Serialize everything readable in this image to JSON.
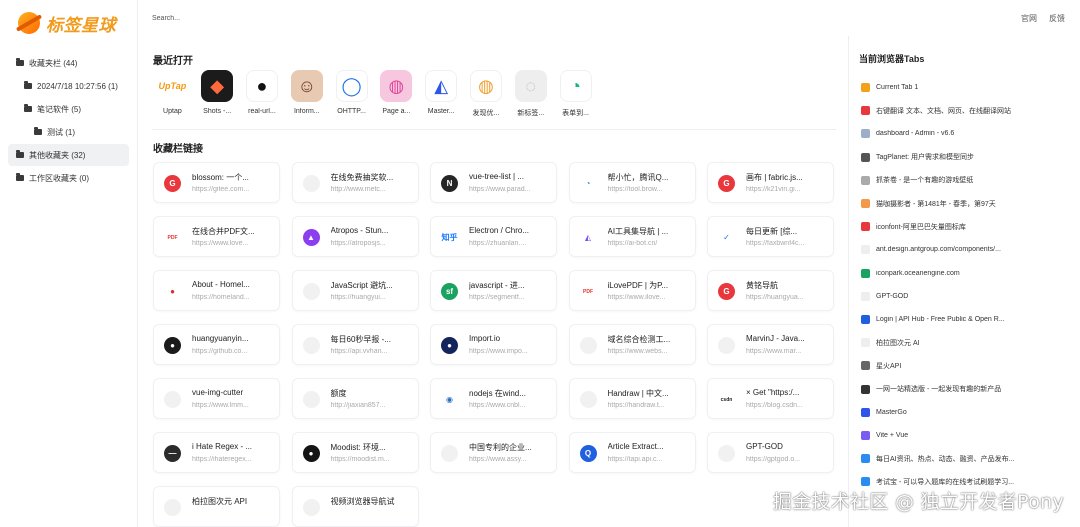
{
  "app": {
    "name": "标签星球"
  },
  "search": {
    "placeholder": "Search..."
  },
  "top_links": [
    "官网",
    "反馈"
  ],
  "sidebar": {
    "items": [
      {
        "label": "收藏夹栏 (44)",
        "level": 0,
        "active": false
      },
      {
        "label": "2024/7/18 10:27:56 (1)",
        "level": 1,
        "active": false
      },
      {
        "label": "笔记软件 (5)",
        "level": 1,
        "active": false
      },
      {
        "label": "测试 (1)",
        "level": 2,
        "active": false
      },
      {
        "label": "其他收藏夹 (32)",
        "level": 0,
        "active": true
      },
      {
        "label": "工作区收藏夹 (0)",
        "level": 0,
        "active": false
      }
    ]
  },
  "recent": {
    "title": "最近打开",
    "items": [
      {
        "label": "Uptap",
        "icon": "uptap-logo",
        "color": "#ffffff",
        "glyph": "UpTap",
        "fg": "#f59a12"
      },
      {
        "label": "Shots -...",
        "icon": "shots-logo",
        "color": "#1b1b1b",
        "glyph": "◆",
        "fg": "#ff6a3c"
      },
      {
        "label": "real-url...",
        "icon": "github-logo",
        "color": "#ffffff",
        "glyph": "●",
        "fg": "#111111"
      },
      {
        "label": "Inform...",
        "icon": "avatar-photo",
        "color": "#e8c9b2",
        "glyph": "☺",
        "fg": "#6b3d2a"
      },
      {
        "label": "OHTTP...",
        "icon": "ring-logo",
        "color": "#ffffff",
        "glyph": "◯",
        "fg": "#1e6fe8"
      },
      {
        "label": "Page a...",
        "icon": "dribbble-logo",
        "color": "#f6c7de",
        "glyph": "◍",
        "fg": "#e0489a"
      },
      {
        "label": "Master...",
        "icon": "mastergo-logo",
        "color": "#ffffff",
        "glyph": "◭",
        "fg": "#2e55e8"
      },
      {
        "label": "发现优...",
        "icon": "ball-logo",
        "color": "#ffffff",
        "glyph": "◍",
        "fg": "#f0a030"
      },
      {
        "label": "新标签...",
        "icon": "blank-tab-icon",
        "color": "#eeeeee",
        "glyph": "◌",
        "fg": "#bbbbbb"
      },
      {
        "label": "表单到...",
        "icon": "form-logo",
        "color": "#ffffff",
        "glyph": "◔",
        "fg": "#14b87a"
      }
    ]
  },
  "bookmarks": {
    "title": "收藏栏链接",
    "items": [
      {
        "title": "blossom: 一个...",
        "url": "https://gitee.com...",
        "icon": "gitee-icon",
        "color": "#e8383d",
        "glyph": "G"
      },
      {
        "title": "在线免费抽奖软...",
        "url": "http://www.metc...",
        "icon": "blank-icon",
        "color": "#f1f1f1",
        "glyph": ""
      },
      {
        "title": "vue-tree-list | ...",
        "url": "https://www.parad...",
        "icon": "nuxt-icon",
        "color": "#262626",
        "glyph": "N"
      },
      {
        "title": "帮小忙，腾讯Q...",
        "url": "https://tool.brow...",
        "icon": "tencent-icon",
        "color": "#ffffff",
        "glyph": "◔",
        "fg": "#2a8cf0"
      },
      {
        "title": "画布 | fabric.js...",
        "url": "https://k21vin.gi...",
        "icon": "gitee-icon",
        "color": "#e8383d",
        "glyph": "G"
      },
      {
        "title": "在线合并PDF文...",
        "url": "https://www.love...",
        "icon": "ilovepdf-icon",
        "color": "#ffffff",
        "glyph": "PDF",
        "fg": "#e5322d"
      },
      {
        "title": "Atropos - Stun...",
        "url": "https://atroposjs...",
        "icon": "atropos-icon",
        "color": "#8b3ef0",
        "glyph": "▲"
      },
      {
        "title": "Electron / Chro...",
        "url": "https://zhuanlan....",
        "icon": "zhihu-icon",
        "color": "#ffffff",
        "glyph": "知乎",
        "fg": "#1677ff"
      },
      {
        "title": "AI工具集导航 | ...",
        "url": "https://ai-bot.cn/",
        "icon": "aibot-icon",
        "color": "#ffffff",
        "glyph": "◭",
        "fg": "#7b4cf0"
      },
      {
        "title": "每日更新 [综...",
        "url": "https://faxbwnf4c...",
        "icon": "swoosh-icon",
        "color": "#ffffff",
        "glyph": "✓",
        "fg": "#1f6ed4"
      },
      {
        "title": "About - Homel...",
        "url": "https://homeland...",
        "icon": "homeland-icon",
        "color": "#ffffff",
        "glyph": "●",
        "fg": "#d22f2f"
      },
      {
        "title": "JavaScript 避坑...",
        "url": "https://huangyui...",
        "icon": "blank-icon",
        "color": "#f1f1f1",
        "glyph": ""
      },
      {
        "title": "javascript - 进...",
        "url": "https://segmentf...",
        "icon": "segmentfault-icon",
        "color": "#1aa260",
        "glyph": "sf"
      },
      {
        "title": "iLovePDF | 为P...",
        "url": "https://www.ilove...",
        "icon": "ilovepdf-icon",
        "color": "#ffffff",
        "glyph": "PDF",
        "fg": "#e5322d"
      },
      {
        "title": "黄铭导航",
        "url": "https://huangyua...",
        "icon": "gitee-icon",
        "color": "#e8383d",
        "glyph": "G"
      },
      {
        "title": "huangyuanyin...",
        "url": "https://github.co...",
        "icon": "github-icon",
        "color": "#1b1b1b",
        "glyph": "●"
      },
      {
        "title": "每日60秒早报 -...",
        "url": "https://api.vvhan...",
        "icon": "blank-icon",
        "color": "#f1f1f1",
        "glyph": ""
      },
      {
        "title": "Import.io",
        "url": "https://www.impo...",
        "icon": "importio-icon",
        "color": "#14245c",
        "glyph": "●"
      },
      {
        "title": "域名综合检测工...",
        "url": "https://www.webs...",
        "icon": "blank-icon",
        "color": "#f1f1f1",
        "glyph": ""
      },
      {
        "title": "MarvinJ - Java...",
        "url": "https://www.mar...",
        "icon": "blank-icon",
        "color": "#f1f1f1",
        "glyph": ""
      },
      {
        "title": "vue-img-cutter",
        "url": "https://www.lmm...",
        "icon": "blank-icon",
        "color": "#f1f1f1",
        "glyph": ""
      },
      {
        "title": "额度",
        "url": "http://jiaxian857...",
        "icon": "blank-icon",
        "color": "#f1f1f1",
        "glyph": ""
      },
      {
        "title": "nodejs 在wind...",
        "url": "https://www.cnbl...",
        "icon": "cnblogs-icon",
        "color": "#ffffff",
        "glyph": "◉",
        "fg": "#2a6fbf"
      },
      {
        "title": "Handraw | 中文...",
        "url": "https://handraw.t...",
        "icon": "blank-icon",
        "color": "#f1f1f1",
        "glyph": ""
      },
      {
        "title": "× Get \"https:/...",
        "url": "https://blog.csdn...",
        "icon": "csdn-icon",
        "color": "#ffffff",
        "glyph": "csdn",
        "fg": "#222222"
      },
      {
        "title": "i Hate Regex - ...",
        "url": "https://ihateregex...",
        "icon": "ihateregex-icon",
        "color": "#2b2b2b",
        "glyph": "—"
      },
      {
        "title": "Moodist: 环境...",
        "url": "https://moodist.m...",
        "icon": "moodist-icon",
        "color": "#141414",
        "glyph": "●"
      },
      {
        "title": "中国专利的企业...",
        "url": "https://www.assy...",
        "icon": "blank-icon",
        "color": "#f1f1f1",
        "glyph": ""
      },
      {
        "title": "Article Extract...",
        "url": "https://tapi.api.c...",
        "icon": "q-icon",
        "color": "#1f5fe0",
        "glyph": "Q"
      },
      {
        "title": "GPT-GOD",
        "url": "https://gptgod.o...",
        "icon": "blank-icon",
        "color": "#f1f1f1",
        "glyph": ""
      },
      {
        "title": "柏拉图次元 API",
        "url": "",
        "icon": "blank-icon",
        "color": "#f1f1f1",
        "glyph": ""
      },
      {
        "title": "视频浏览器导航试",
        "url": "",
        "icon": "blank-icon",
        "color": "#f1f1f1",
        "glyph": ""
      }
    ]
  },
  "browser_tabs": {
    "title": "当前浏览器Tabs",
    "items": [
      {
        "label": "Current Tab 1",
        "icon": "planet-icon",
        "color": "#f2a21a"
      },
      {
        "label": "右键翻译 文本、文档、网页、在线翻译网站",
        "icon": "translate-icon",
        "color": "#e8383d"
      },
      {
        "label": "dashboard - Admin - v6.6",
        "icon": "dashboard-icon",
        "color": "#9bb0c8"
      },
      {
        "label": "TagPlanet: 用户需求和模型同步",
        "icon": "github-icon",
        "color": "#555555"
      },
      {
        "label": "抓茶卷 - 是一个有趣的游戏壁纸",
        "icon": "leaf-icon",
        "color": "#aaaaaa"
      },
      {
        "label": "猫咖摄影者 - 第1481年 - 春季，第97天",
        "icon": "cat-icon",
        "color": "#f29a4a"
      },
      {
        "label": "iconfont-阿里巴巴矢量图标库",
        "icon": "iconfont-icon",
        "color": "#e8383d"
      },
      {
        "label": "ant.design.antgroup.com/components/...",
        "icon": "blank-icon",
        "color": "#eeeeee"
      },
      {
        "label": "iconpark.oceanengine.com",
        "icon": "iconpark-icon",
        "color": "#1aa260"
      },
      {
        "label": "GPT-GOD",
        "icon": "blank-icon",
        "color": "#eeeeee"
      },
      {
        "label": "Login | API Hub - Free Public & Open R...",
        "icon": "q-icon",
        "color": "#1f5fe0"
      },
      {
        "label": "柏拉图次元 AI",
        "icon": "blank-icon",
        "color": "#eeeeee"
      },
      {
        "label": "星火API",
        "icon": "spark-icon",
        "color": "#666666"
      },
      {
        "label": "一网一站精选版 - 一起发现有趣的新产品",
        "icon": "m-icon",
        "color": "#333333"
      },
      {
        "label": "MasterGo",
        "icon": "mastergo-icon",
        "color": "#2e55e8"
      },
      {
        "label": "Vite + Vue",
        "icon": "vite-icon",
        "color": "#7a5cf0"
      },
      {
        "label": "每日AI资讯、热点、动态、融资、产品发布...",
        "icon": "ai-news-icon",
        "color": "#2a8cf0"
      },
      {
        "label": "考试宝 - 可以导入题库的在线考试刷题学习...",
        "icon": "exam-icon",
        "color": "#2a8cf0"
      }
    ]
  },
  "watermark": "掘金技术社区 @ 独立开发者Pony"
}
